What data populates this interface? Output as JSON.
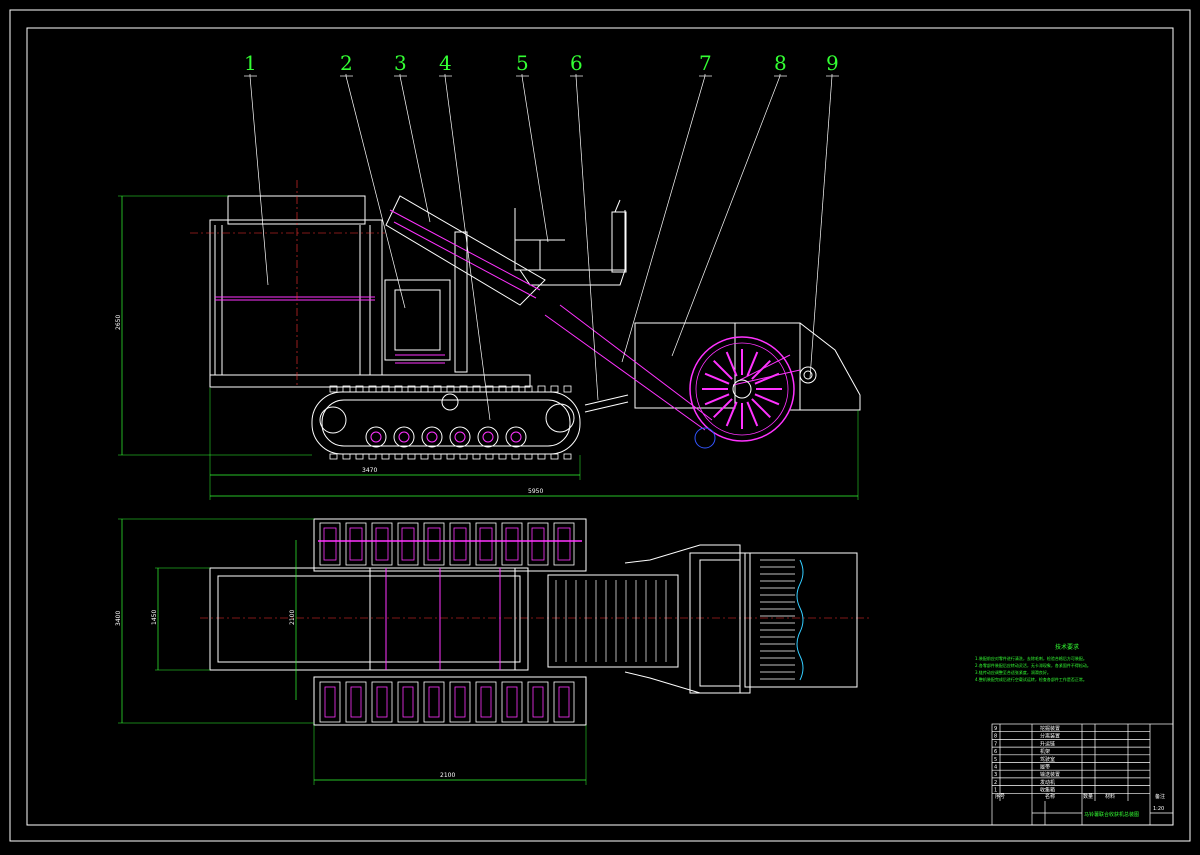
{
  "drawing": {
    "part_labels": [
      "1",
      "2",
      "3",
      "4",
      "5",
      "6",
      "7",
      "8",
      "9"
    ],
    "dimensions": {
      "overall_height": "2650",
      "track_length": "3470",
      "overall_length": "5950",
      "plan_width_total": "3400",
      "plan_width_bin": "1450",
      "plan_width_track": "2100",
      "track_width": "2100"
    },
    "notes": {
      "heading": "技术要求",
      "lines": [
        "1.装配前应对零件进行清洗，去除毛刺，检验合格后方可装配。",
        "2.各零部件装配后应转动灵活，无卡滞现象，各紧固件不得松动。",
        "3.链传动应调整至合适张紧度，润滑良好。",
        "4.整机装配完成后进行空载试运转，检查各部件工作是否正常。"
      ]
    },
    "title_block": {
      "parts_rows": [
        {
          "no": "9",
          "name": "挖掘装置"
        },
        {
          "no": "8",
          "name": "分离装置"
        },
        {
          "no": "7",
          "name": "升运链"
        },
        {
          "no": "6",
          "name": "机架"
        },
        {
          "no": "5",
          "name": "驾驶室"
        },
        {
          "no": "4",
          "name": "履带"
        },
        {
          "no": "3",
          "name": "输送装置"
        },
        {
          "no": "2",
          "name": "发动机"
        },
        {
          "no": "1",
          "name": "收集箱"
        }
      ],
      "header": {
        "no": "序号",
        "name": "名称",
        "qty": "数量",
        "material": "材料",
        "note": "备注"
      },
      "title": "马铃薯联合收获机总装图",
      "scale": "1:20"
    },
    "colors": {
      "background": "#000000",
      "outline": "#ffffff",
      "label": "#33ff33",
      "mechanism": "#ff33ff",
      "center": "#ff3333",
      "cyan": "#33ccff"
    }
  }
}
